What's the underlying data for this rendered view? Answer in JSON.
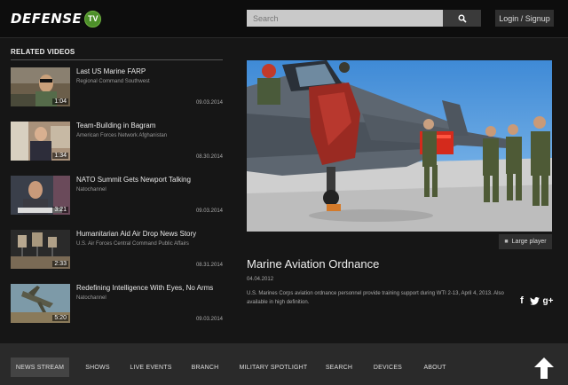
{
  "header": {
    "logo_text": "DEFENSE",
    "logo_badge": "TV",
    "search_placeholder": "Search",
    "login_label": "Login / Signup"
  },
  "related": {
    "heading": "RELATED VIDEOS",
    "items": [
      {
        "title": "Last US Marine FARP",
        "source": "Regional Command Southwest",
        "date": "09.03.2014",
        "duration": "1:04"
      },
      {
        "title": "Team-Building in Bagram",
        "source": "American Forces Network Afghanistan",
        "date": "08.30.2014",
        "duration": "1:34"
      },
      {
        "title": "NATO Summit Gets Newport Talking",
        "source": "Natochannel",
        "date": "09.03.2014",
        "duration": "3:21"
      },
      {
        "title": "Humanitarian Aid Air Drop News Story",
        "source": "U.S. Air Forces Central Command Public Affairs",
        "date": "08.31.2014",
        "duration": "2:33"
      },
      {
        "title": "Redefining Intelligence With Eyes, No Arms",
        "source": "Natochannel",
        "date": "09.03.2014",
        "duration": "5:20"
      }
    ]
  },
  "video": {
    "large_player_label": "Large player",
    "title": "Marine Aviation Ordnance",
    "date": "04.04.2012",
    "description": "U.S. Marines Corps aviation ordnance personnel provide training support during WTI 2-13, April 4, 2013. Also available in high definition."
  },
  "share": {
    "facebook": "f",
    "google": "g+"
  },
  "nav": {
    "items": [
      "NEWS STREAM",
      "SHOWS",
      "LIVE EVENTS",
      "BRANCH",
      "MILITARY SPOTLIGHT",
      "SEARCH",
      "DEVICES",
      "ABOUT"
    ]
  },
  "colors": {
    "accent_green": "#4d8f2a",
    "background": "#161616",
    "footer": "#2a2a2a"
  }
}
